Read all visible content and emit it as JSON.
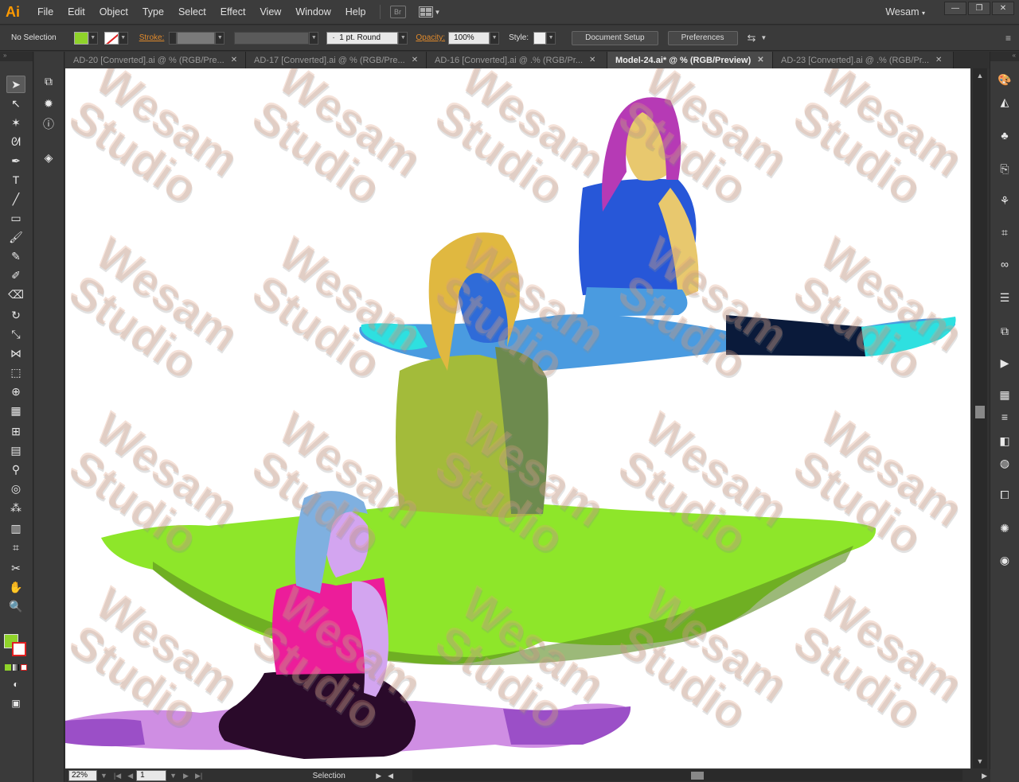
{
  "app": {
    "logo": "Ai",
    "user": "Wesam"
  },
  "menu": [
    "File",
    "Edit",
    "Object",
    "Type",
    "Select",
    "Effect",
    "View",
    "Window",
    "Help"
  ],
  "bridge_label": "Br",
  "window_controls": {
    "minimize": "—",
    "restore": "❐",
    "close": "✕"
  },
  "control": {
    "selection_label": "No Selection",
    "stroke_label": "Stroke:",
    "brush_value": "1 pt. Round",
    "opacity_label": "Opacity:",
    "opacity_value": "100%",
    "style_label": "Style:",
    "document_setup": "Document Setup",
    "preferences": "Preferences"
  },
  "tabs": [
    {
      "label": "AD-20 [Converted].ai @ % (RGB/Pre...",
      "active": false
    },
    {
      "label": "AD-17 [Converted].ai @ % (RGB/Pre...",
      "active": false
    },
    {
      "label": "AD-16 [Converted].ai @ .% (RGB/Pr...",
      "active": false
    },
    {
      "label": "Model-24.ai* @ % (RGB/Preview)",
      "active": true
    },
    {
      "label": "AD-23 [Converted].ai @ .% (RGB/Pr...",
      "active": false
    }
  ],
  "status": {
    "zoom": "22%",
    "page": "1",
    "mode": "Selection"
  },
  "watermark": {
    "line1": "Wesam",
    "line2": "Studio"
  },
  "colors": {
    "fill": "#8fd32a",
    "accent": "#ff9a00",
    "stroke_link": "#e08a2c"
  }
}
